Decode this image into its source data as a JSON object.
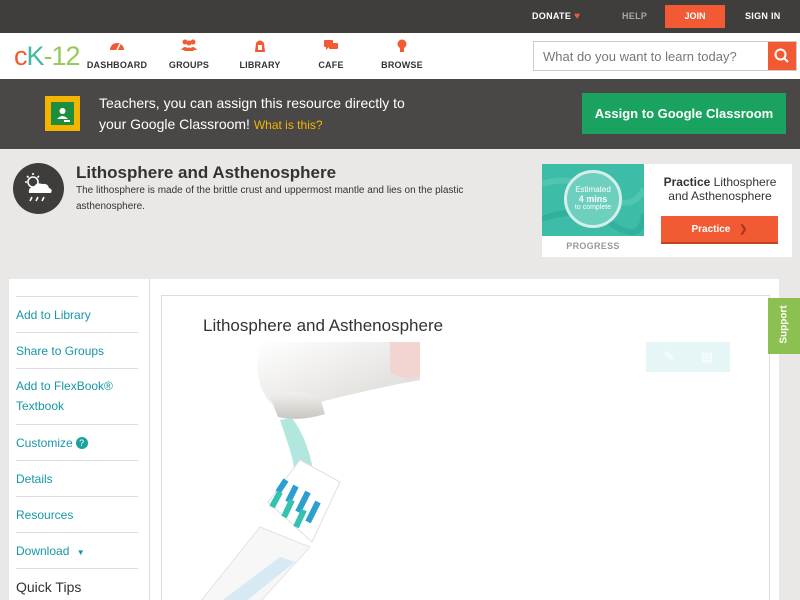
{
  "topbar": {
    "donate": "DONATE",
    "help": "HELP",
    "join": "JOIN",
    "signin": "SIGN IN"
  },
  "logo": {
    "c": "c",
    "k": "K",
    "dash": "-",
    "n": "12"
  },
  "nav": {
    "items": [
      {
        "label": "DASHBOARD",
        "icon": "dashboard-icon"
      },
      {
        "label": "GROUPS",
        "icon": "groups-icon"
      },
      {
        "label": "LIBRARY",
        "icon": "library-icon"
      },
      {
        "label": "CAFE",
        "icon": "cafe-icon"
      },
      {
        "label": "BROWSE",
        "icon": "browse-icon"
      }
    ]
  },
  "search": {
    "placeholder": "What do you want to learn today?"
  },
  "classroom": {
    "line1": "Teachers, you can assign this resource directly to",
    "line2": "your Google Classroom!",
    "what": "What is this?",
    "assign": "Assign to Google Classroom"
  },
  "concept": {
    "title": "Lithosphere and Asthenosphere",
    "description": "The lithosphere is made of the brittle crust and uppermost mantle and lies on the plastic asthenosphere."
  },
  "practice": {
    "estimated": "Estimated",
    "mins": "4 mins",
    "complete": "to complete",
    "progress_label": "PROGRESS",
    "title_bold": "Practice",
    "title_rest": "Lithosphere and Asthenosphere",
    "button": "Practice"
  },
  "sidebar": {
    "items": [
      "Add to Library",
      "Share to Groups",
      "Add to FlexBook®",
      "Textbook",
      "Customize",
      "Details",
      "Resources",
      "Download",
      "Quick Tips"
    ]
  },
  "content": {
    "title": "Lithosphere and Asthenosphere"
  },
  "support": "Support",
  "colors": {
    "accent": "#f15a33",
    "teal": "#1896a6",
    "green": "#1aa260",
    "dark": "#4a4846"
  }
}
